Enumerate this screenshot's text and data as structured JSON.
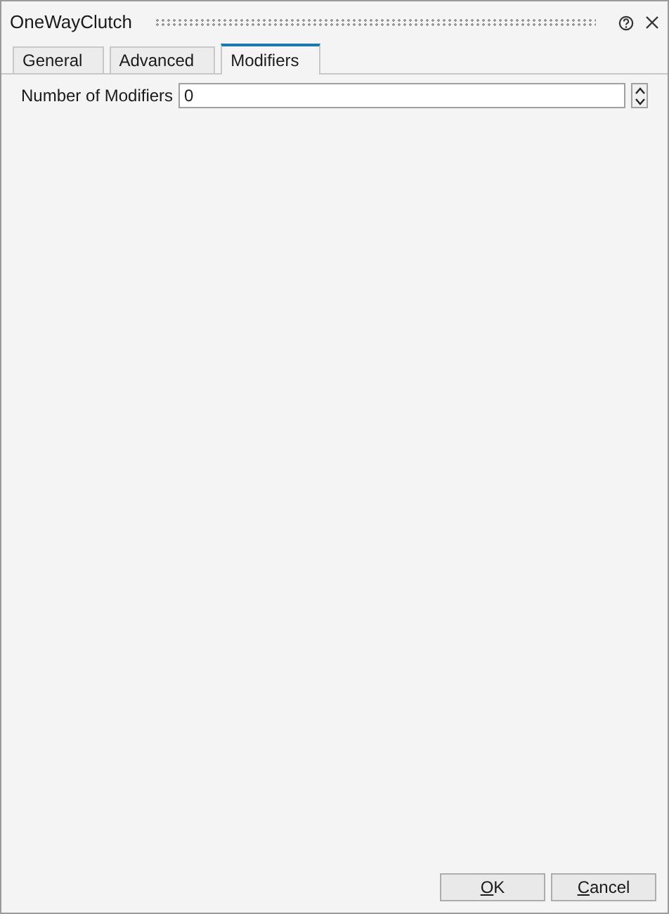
{
  "window": {
    "title": "OneWayClutch"
  },
  "tabs": [
    {
      "label": "General",
      "selected": false
    },
    {
      "label": "Advanced",
      "selected": false
    },
    {
      "label": "Modifiers",
      "selected": true
    }
  ],
  "fields": [
    {
      "label": "Number of Modifiers",
      "value": "0"
    }
  ],
  "buttons": [
    "OK",
    "Cancel"
  ]
}
